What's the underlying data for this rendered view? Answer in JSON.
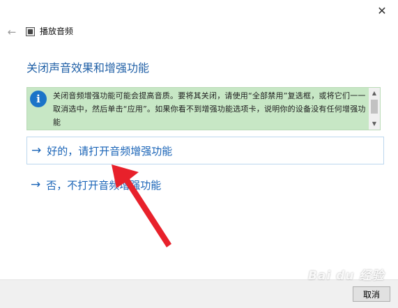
{
  "window": {
    "title": "播放音频",
    "close_glyph": "✕",
    "back_glyph": "←"
  },
  "heading": "关闭声音效果和增强功能",
  "info": {
    "icon_glyph": "i",
    "text": "关闭音频增强功能可能会提高音质。要将其关闭，请使用“全部禁用”复选框，或将它们一一取消选中，然后单击“应用”。如果你看不到增强功能选项卡，说明你的设备没有任何增强功能",
    "scroll_up_glyph": "▲",
    "scroll_down_glyph": "▼"
  },
  "options": [
    {
      "arrow": "→",
      "label": "好的，请打开音频增强功能",
      "selected": true
    },
    {
      "arrow": "→",
      "label": "否，不打开音频增强功能",
      "selected": false
    }
  ],
  "footer": {
    "cancel_label": "取消"
  },
  "watermark": "Bai du 经验",
  "colors": {
    "heading": "#1f5fa6",
    "link": "#1a64b7",
    "info_bg": "#c7e7c5",
    "annotation_arrow": "#e8212b"
  }
}
